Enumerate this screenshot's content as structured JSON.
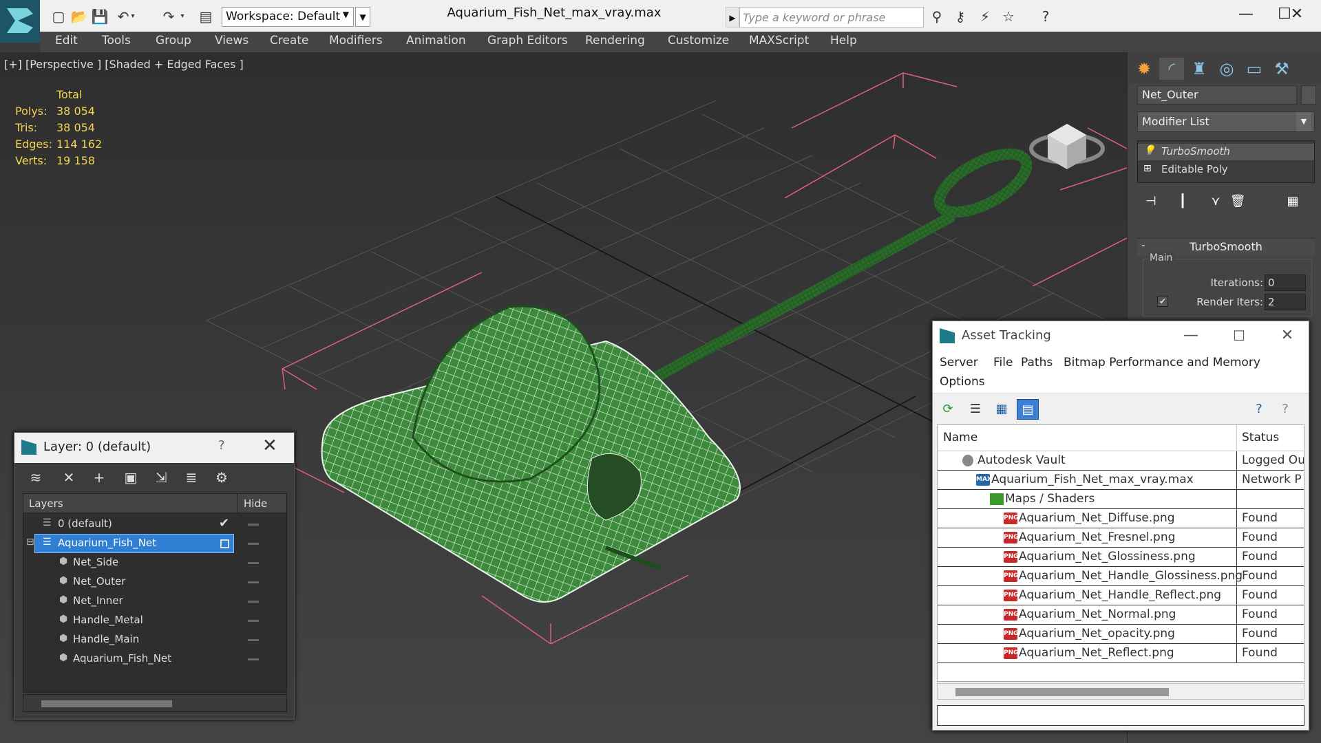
{
  "app": {
    "title": "Aquarium_Fish_Net_max_vray.max",
    "workspace": "Workspace: Default",
    "search_placeholder": "Type a keyword or phrase"
  },
  "menu": [
    "Edit",
    "Tools",
    "Group",
    "Views",
    "Create",
    "Modifiers",
    "Animation",
    "Graph Editors",
    "Rendering",
    "Customize",
    "MAXScript",
    "Help"
  ],
  "viewport": {
    "label": "[+] [Perspective ] [Shaded + Edged Faces ]",
    "stats": {
      "header": "Total",
      "rows": [
        {
          "label": "Polys:",
          "value": "38 054"
        },
        {
          "label": "Tris:",
          "value": "38 054"
        },
        {
          "label": "Edges:",
          "value": "114 162"
        },
        {
          "label": "Verts:",
          "value": "19 158"
        }
      ]
    }
  },
  "command_panel": {
    "object_name": "Net_Outer",
    "modifier_list": "Modifier List",
    "stack": [
      "TurboSmooth",
      "Editable Poly"
    ],
    "rollout_title": "TurboSmooth",
    "group_title": "Main",
    "iterations_label": "Iterations:",
    "iterations_value": "0",
    "render_iters_label": "Render Iters:",
    "render_iters_value": "2"
  },
  "layer_dialog": {
    "title": "Layer: 0 (default)",
    "help": "?",
    "col_layers": "Layers",
    "col_hide": "Hide",
    "rows": [
      {
        "name": "0 (default)",
        "level": 0,
        "type": "layer"
      },
      {
        "name": "Aquarium_Fish_Net",
        "level": 0,
        "type": "layer",
        "selected": true
      },
      {
        "name": "Net_Side",
        "level": 1,
        "type": "object"
      },
      {
        "name": "Net_Outer",
        "level": 1,
        "type": "object"
      },
      {
        "name": "Net_Inner",
        "level": 1,
        "type": "object"
      },
      {
        "name": "Handle_Metal",
        "level": 1,
        "type": "object"
      },
      {
        "name": "Handle_Main",
        "level": 1,
        "type": "object"
      },
      {
        "name": "Aquarium_Fish_Net",
        "level": 1,
        "type": "object"
      }
    ]
  },
  "asset_dialog": {
    "title": "Asset Tracking",
    "menu": [
      "Server",
      "File",
      "Paths",
      "Bitmap Performance and Memory",
      "Options"
    ],
    "col_name": "Name",
    "col_status": "Status",
    "rows": [
      {
        "name": "Autodesk Vault",
        "status": "Logged Ou",
        "level": 0,
        "icon": "vault"
      },
      {
        "name": "Aquarium_Fish_Net_max_vray.max",
        "status": "Network P",
        "level": 1,
        "icon": "max"
      },
      {
        "name": "Maps / Shaders",
        "status": "",
        "level": 2,
        "icon": "maps"
      },
      {
        "name": "Aquarium_Net_Diffuse.png",
        "status": "Found",
        "level": 3,
        "icon": "png"
      },
      {
        "name": "Aquarium_Net_Fresnel.png",
        "status": "Found",
        "level": 3,
        "icon": "png"
      },
      {
        "name": "Aquarium_Net_Glossiness.png",
        "status": "Found",
        "level": 3,
        "icon": "png"
      },
      {
        "name": "Aquarium_Net_Handle_Glossiness.png",
        "status": "Found",
        "level": 3,
        "icon": "png"
      },
      {
        "name": "Aquarium_Net_Handle_Reflect.png",
        "status": "Found",
        "level": 3,
        "icon": "png"
      },
      {
        "name": "Aquarium_Net_Normal.png",
        "status": "Found",
        "level": 3,
        "icon": "png"
      },
      {
        "name": "Aquarium_Net_opacity.png",
        "status": "Found",
        "level": 3,
        "icon": "png"
      },
      {
        "name": "Aquarium_Net_Reflect.png",
        "status": "Found",
        "level": 3,
        "icon": "png"
      }
    ]
  },
  "colors": {
    "stats": "#f3d34f",
    "selection": "#2f7fd4",
    "net_green": "#2e7a2e",
    "bbox_pink": "#e0607a"
  }
}
